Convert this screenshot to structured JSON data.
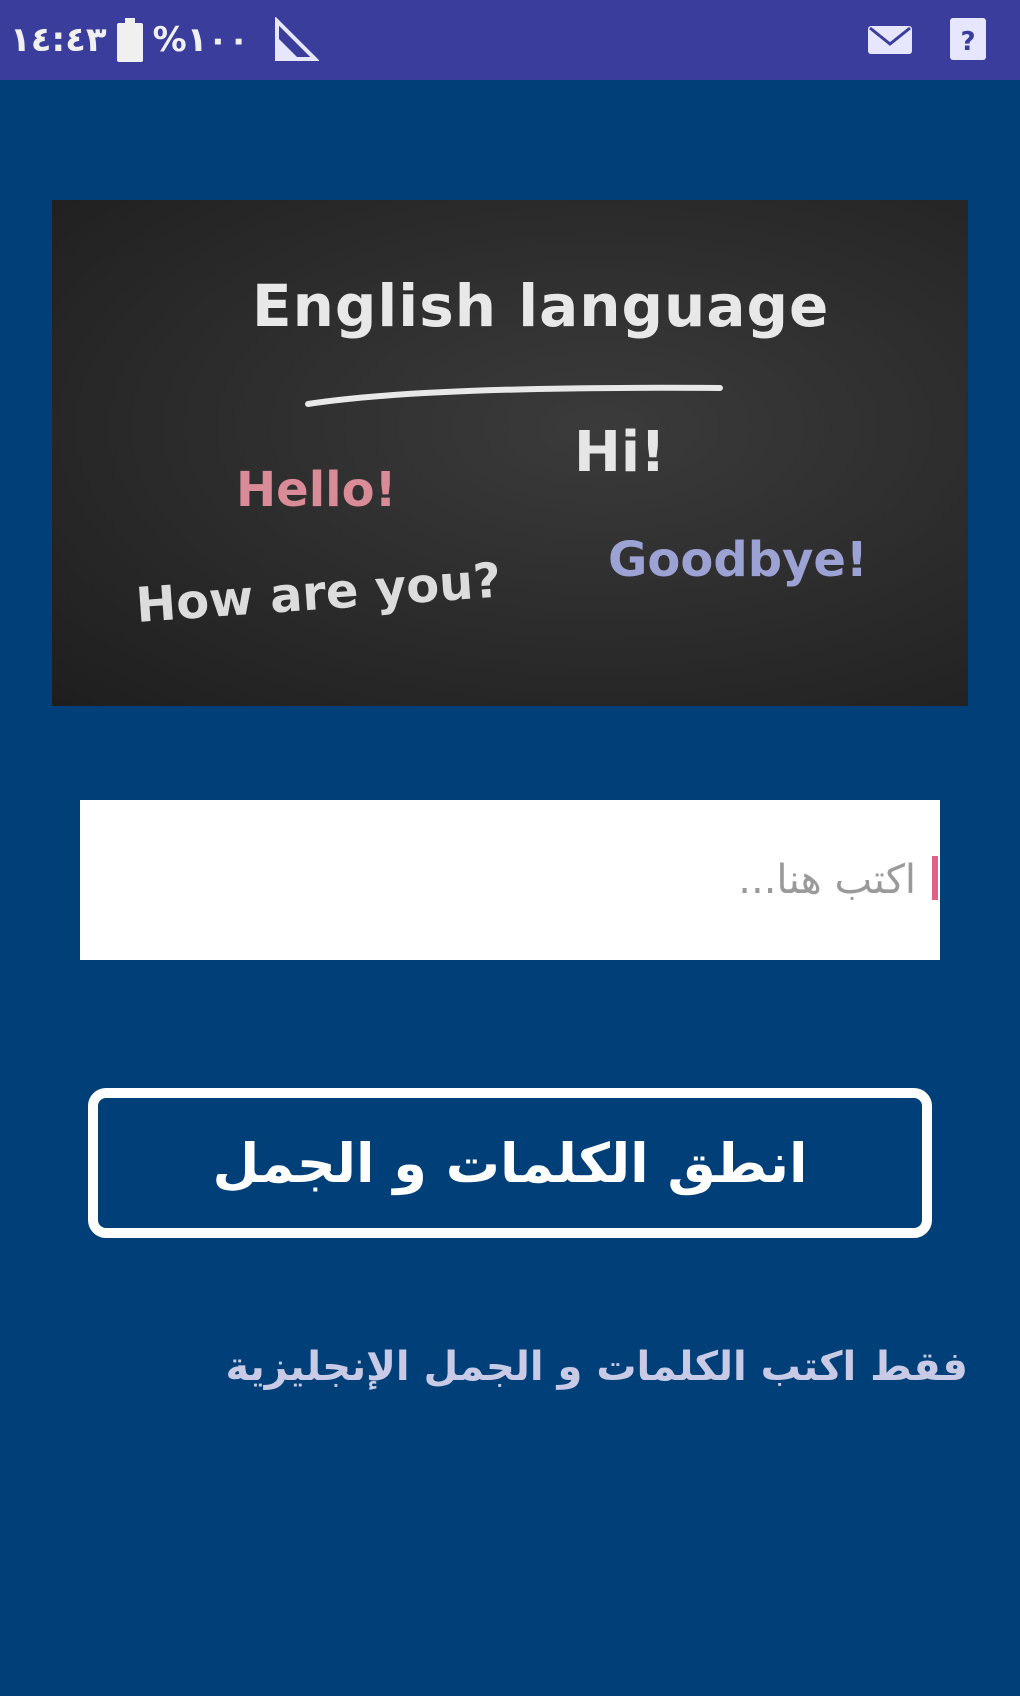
{
  "status_bar": {
    "time": "١٤:٤٣",
    "battery_percent": "%١٠٠",
    "icons": [
      "battery-icon",
      "signal-icon",
      "mail-icon",
      "sim-icon"
    ]
  },
  "hero_image": {
    "title": "English language",
    "words": {
      "hi": "Hi!",
      "hello": "Hello!",
      "goodbye": "Goodbye!",
      "how": "How are you?"
    },
    "colors": {
      "hello": "#d98b97",
      "goodbye": "#9ca3d4",
      "chalk": "#e8e8e8"
    }
  },
  "input": {
    "placeholder": "اكتب هنا...",
    "value": ""
  },
  "speak_button": {
    "label": "انطق الكلمات و الجمل"
  },
  "hint": {
    "text": "فقط اكتب الكلمات و الجمل الإنجليزية"
  },
  "theme": {
    "background": "#003f78",
    "status_bar": "#3a3d9c"
  }
}
